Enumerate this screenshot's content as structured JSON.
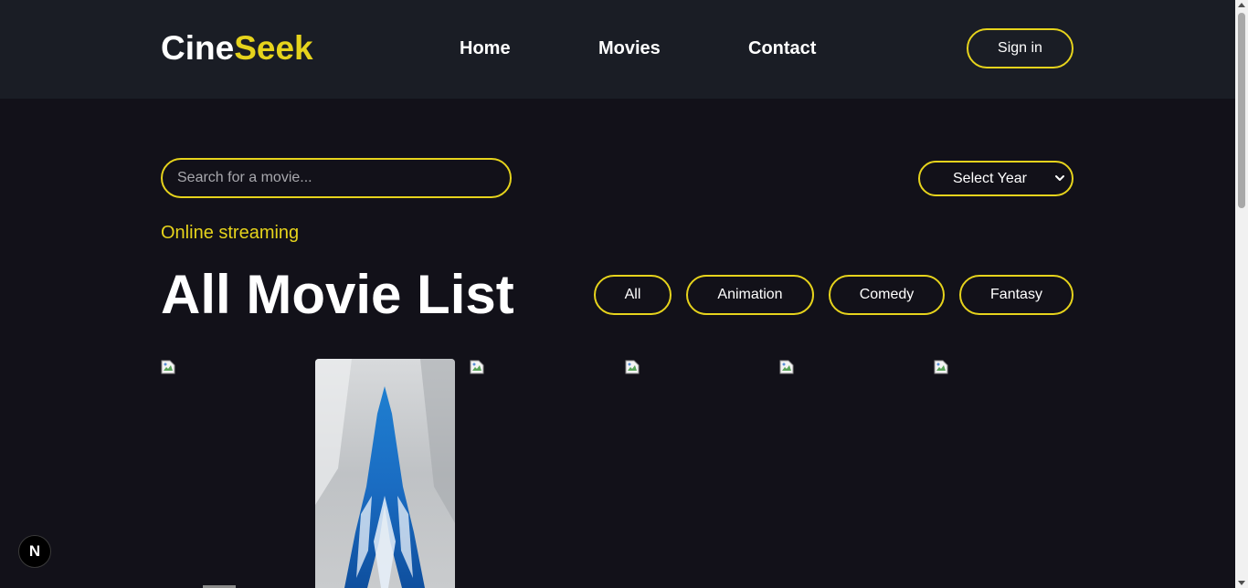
{
  "header": {
    "logo_part1": "Cine",
    "logo_part2": "Seek",
    "nav": [
      {
        "label": "Home"
      },
      {
        "label": "Movies"
      },
      {
        "label": "Contact"
      }
    ],
    "signin_label": "Sign in"
  },
  "search": {
    "placeholder": "Search for a movie...",
    "value": ""
  },
  "year_filter": {
    "selected": "Select Year"
  },
  "section": {
    "subtitle": "Online streaming",
    "title": "All Movie List"
  },
  "genres": [
    {
      "label": "All"
    },
    {
      "label": "Animation"
    },
    {
      "label": "Comedy"
    },
    {
      "label": "Fantasy"
    }
  ],
  "movies": [
    {
      "image": "broken-image-icon"
    },
    {
      "image": "poster"
    },
    {
      "image": "broken-image-icon"
    },
    {
      "image": "broken-image-icon"
    },
    {
      "image": "broken-image-icon"
    },
    {
      "image": "broken-image-icon"
    }
  ],
  "dev_badge": {
    "label": "N"
  },
  "colors": {
    "accent": "#e6d31c",
    "background": "#121119",
    "header_background": "#1a1d25"
  }
}
